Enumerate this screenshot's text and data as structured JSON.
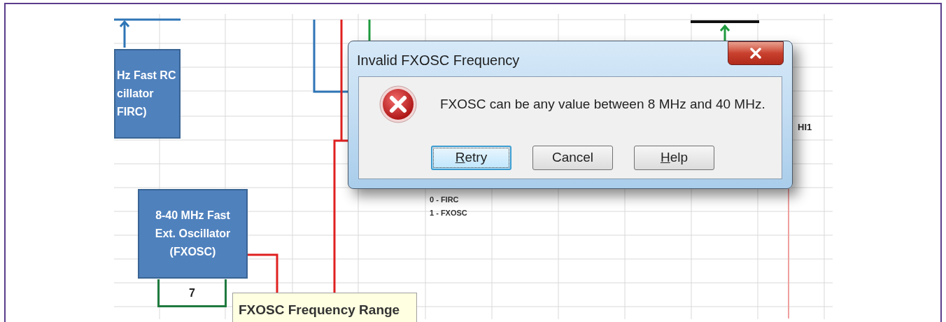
{
  "sheet": {
    "blocks": [
      {
        "kind": "firc",
        "lines": [
          "Hz Fast RC",
          "cillator",
          "FIRC)"
        ]
      },
      {
        "kind": "fxosc",
        "lines": [
          "8-40 MHz Fast",
          "Ext. Oscillator",
          "(FXOSC)"
        ]
      }
    ],
    "cell_value": "7",
    "select_labels": [
      "0 - FIRC",
      "1 - FXOSC"
    ],
    "side_label": "HI1",
    "tooltip": {
      "title": "FXOSC Frequency Range"
    }
  },
  "dialog": {
    "title": "Invalid FXOSC Frequency",
    "message": "FXOSC can be any value between 8 MHz and 40 MHz.",
    "buttons": [
      {
        "label": "Retry",
        "default": true,
        "access_key": true
      },
      {
        "label": "Cancel",
        "default": false,
        "access_key": false
      },
      {
        "label": "Help",
        "default": false,
        "access_key": true
      }
    ]
  }
}
